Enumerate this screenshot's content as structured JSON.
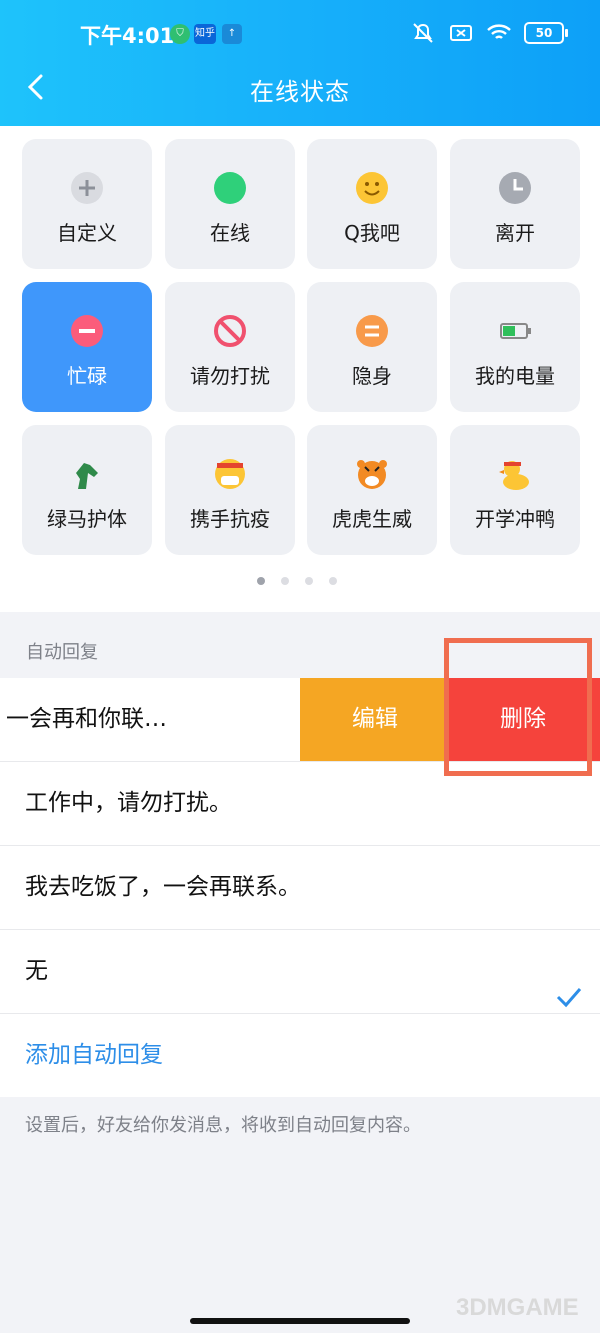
{
  "status_bar": {
    "time": "下午4:01",
    "badge_zhihu": "知乎",
    "battery": "50"
  },
  "nav": {
    "title": "在线状态"
  },
  "statuses": [
    {
      "label": "自定义",
      "icon": "plus-icon"
    },
    {
      "label": "在线",
      "icon": "green-dot-icon"
    },
    {
      "label": "Q我吧",
      "icon": "smile-icon"
    },
    {
      "label": "离开",
      "icon": "clock-icon"
    },
    {
      "label": "忙碌",
      "icon": "minus-icon",
      "selected": true
    },
    {
      "label": "请勿打扰",
      "icon": "forbidden-icon"
    },
    {
      "label": "隐身",
      "icon": "equal-icon"
    },
    {
      "label": "我的电量",
      "icon": "battery-icon"
    },
    {
      "label": "绿马护体",
      "icon": "green-horse-icon"
    },
    {
      "label": "携手抗疫",
      "icon": "mask-face-icon"
    },
    {
      "label": "虎虎生威",
      "icon": "tiger-icon"
    },
    {
      "label": "开学冲鸭",
      "icon": "duck-icon"
    }
  ],
  "auto_reply": {
    "section_title": "自动回复",
    "items": [
      {
        "text": "一会再和你联…",
        "edit_label": "编辑",
        "delete_label": "删除"
      },
      {
        "text": "工作中，请勿打扰。"
      },
      {
        "text": "我去吃饭了，一会再联系。"
      },
      {
        "text": "无",
        "checked": true
      }
    ],
    "add_label": "添加自动回复",
    "footnote": "设置后，好友给你发消息，将收到自动回复内容。"
  },
  "watermark": "3DMGAME",
  "colors": {
    "header": "#17b0fa",
    "selected_tile": "#3f97fb",
    "edit": "#f5a623",
    "delete": "#f5433c",
    "link": "#2d8ee8"
  }
}
